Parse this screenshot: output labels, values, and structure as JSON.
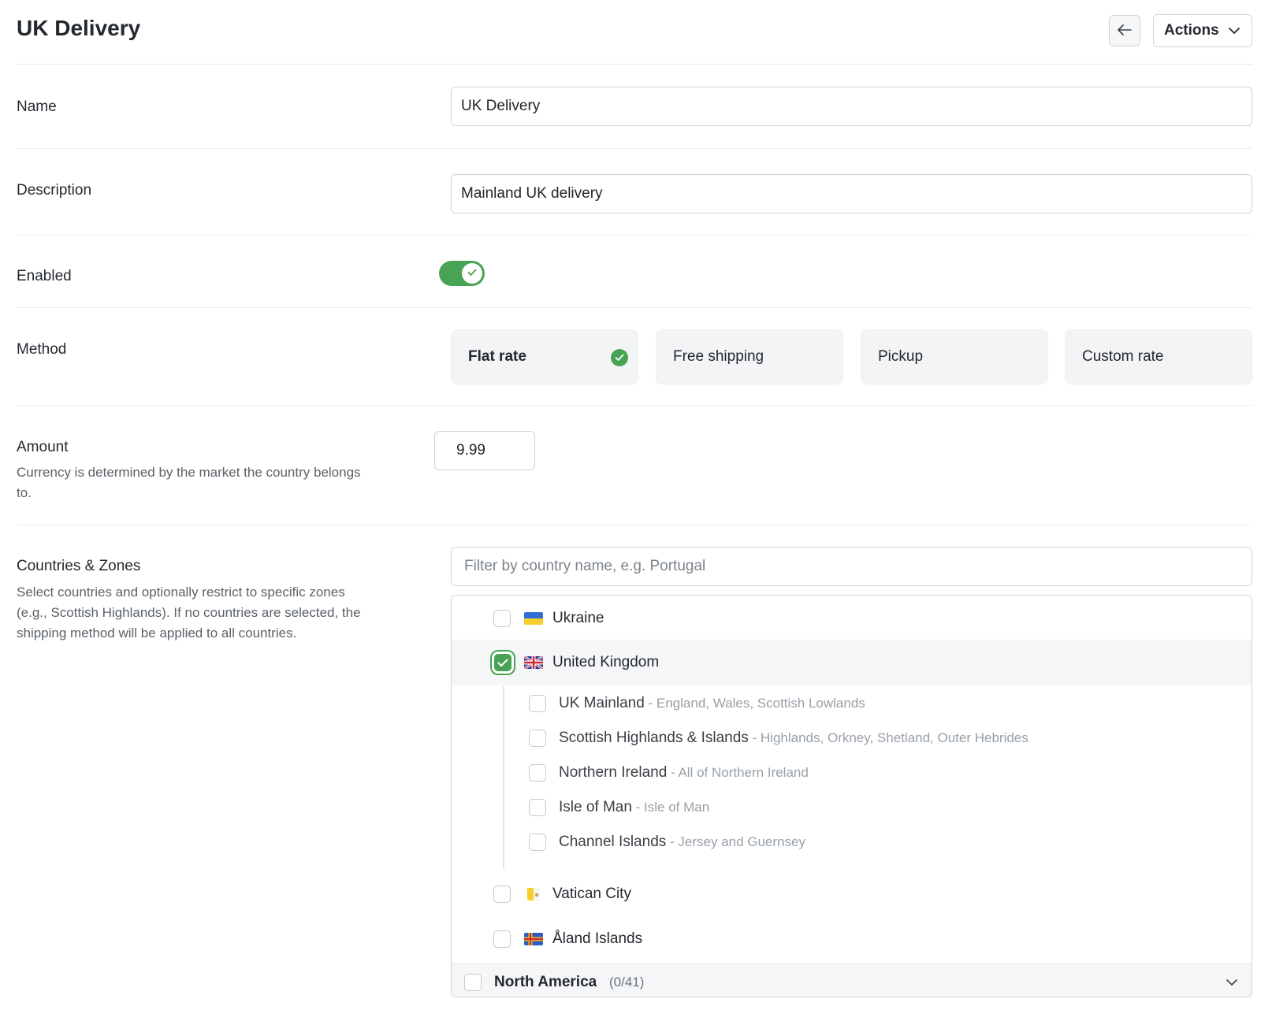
{
  "header": {
    "title": "UK Delivery",
    "back_icon": "arrow-left-icon",
    "actions_label": "Actions"
  },
  "form": {
    "name": {
      "label": "Name",
      "value": "UK Delivery"
    },
    "description": {
      "label": "Description",
      "value": "Mainland UK delivery"
    },
    "enabled": {
      "label": "Enabled",
      "value": true
    },
    "method": {
      "label": "Method",
      "options": [
        "Flat rate",
        "Free shipping",
        "Pickup",
        "Custom rate"
      ],
      "selected": "Flat rate"
    },
    "amount": {
      "label": "Amount",
      "help": "Currency is determined by the market the country belongs to.",
      "value": "9.99"
    },
    "countries": {
      "label": "Countries & Zones",
      "help": "Select countries and optionally restrict to specific zones (e.g., Scottish Highlands). If no countries are selected, the shipping method will be applied to all countries.",
      "filter_placeholder": "Filter by country name, e.g. Portugal",
      "items": [
        {
          "name": "Ukraine",
          "checked": false
        },
        {
          "name": "United Kingdom",
          "checked": true
        },
        {
          "name": "Vatican City",
          "checked": false
        },
        {
          "name": "Åland Islands",
          "checked": false
        }
      ],
      "zones": [
        {
          "name": "UK Mainland",
          "desc": " - England, Wales, Scottish Lowlands",
          "checked": false
        },
        {
          "name": "Scottish Highlands & Islands",
          "desc": " - Highlands, Orkney, Shetland, Outer Hebrides",
          "checked": false
        },
        {
          "name": "Northern Ireland",
          "desc": " - All of Northern Ireland",
          "checked": false
        },
        {
          "name": "Isle of Man",
          "desc": " - Isle of Man",
          "checked": false
        },
        {
          "name": "Channel Islands",
          "desc": " - Jersey and Guernsey",
          "checked": false
        }
      ],
      "region": {
        "name": "North America",
        "count": "(0/41)"
      }
    }
  },
  "colors": {
    "accent": "#48a355",
    "card_bg": "#f3f4f6",
    "muted_text": "#98a0a8"
  }
}
